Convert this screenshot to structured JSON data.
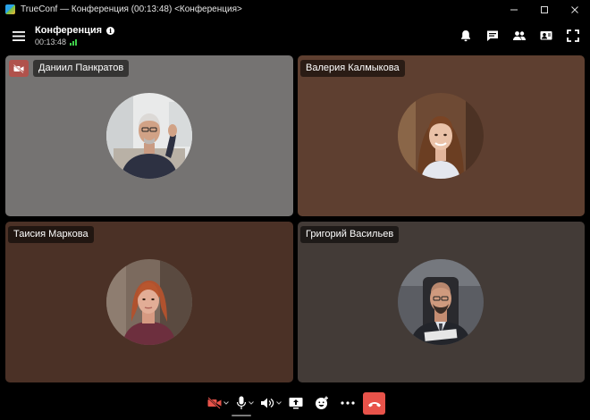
{
  "window": {
    "title": "TrueConf — Конференция (00:13:48)  <Конференция>",
    "controls": [
      "minimize-icon",
      "maximize-icon",
      "close-icon"
    ]
  },
  "header": {
    "conference_title": "Конференция",
    "info_glyph": "i",
    "timer": "00:13:48",
    "actions": [
      "bell-icon",
      "chat-icon",
      "participants-icon",
      "content-icon",
      "fullscreen-icon"
    ]
  },
  "participants": [
    {
      "name": "Даниил Панкратов",
      "camera_off": true,
      "tile_color": "#757372"
    },
    {
      "name": "Валерия Калмыкова",
      "camera_off": false,
      "tile_color": "#5e3f30"
    },
    {
      "name": "Таисия Маркова",
      "camera_off": false,
      "tile_color": "#4b3126"
    },
    {
      "name": "Григорий Васильев",
      "camera_off": false,
      "tile_color": "#433b37"
    }
  ],
  "toolbar": {
    "buttons": [
      "camera-off-icon",
      "microphone-icon",
      "speaker-icon",
      "share-screen-icon",
      "reactions-icon",
      "more-icon",
      "hang-up-icon"
    ],
    "hangup_color": "#e8534a",
    "camera_off_color": "#e8534a"
  },
  "colors": {
    "signal": "#3fcf4a",
    "cam_off_badge": "#b0524c"
  }
}
